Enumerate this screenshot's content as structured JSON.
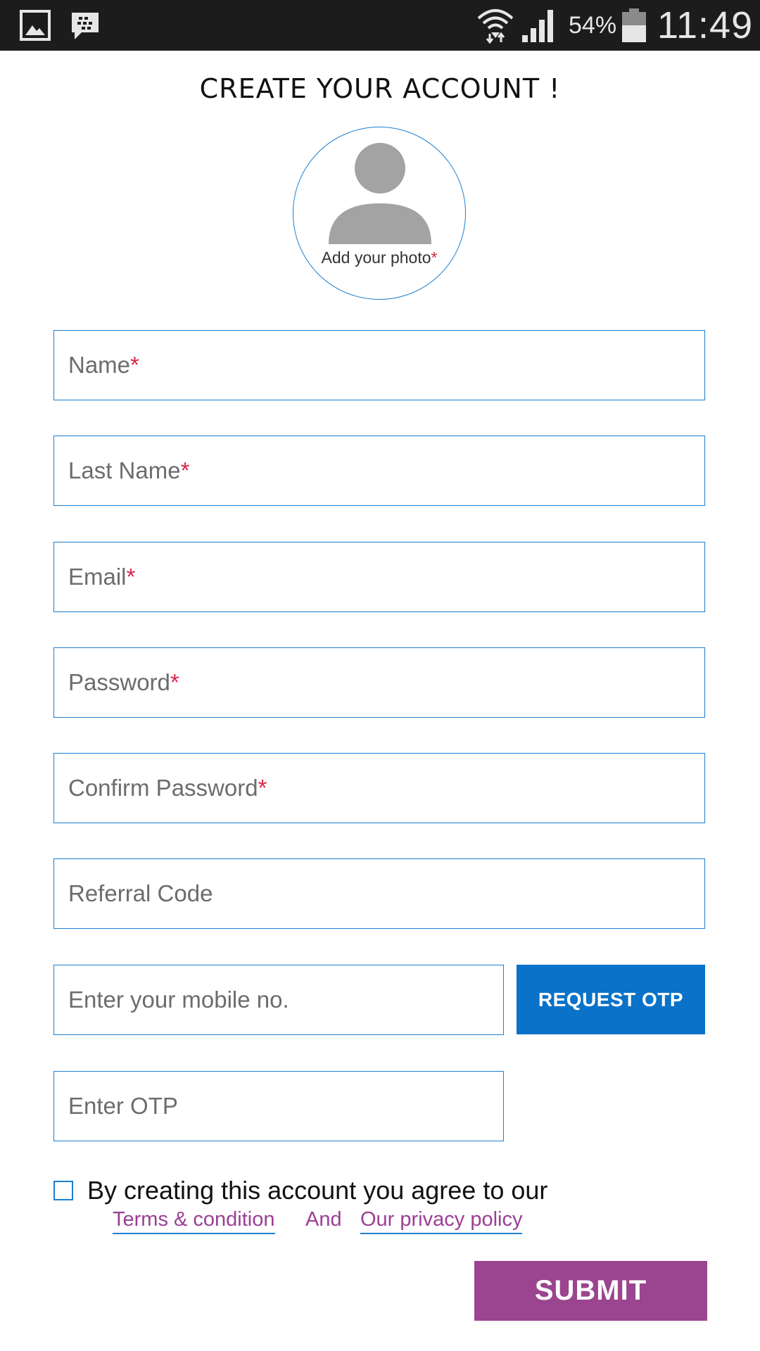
{
  "status_bar": {
    "battery_percent": "54%",
    "time": "11:49",
    "icons": [
      "gallery-icon",
      "bbm-icon",
      "wifi-icon",
      "signal-icon",
      "battery-icon"
    ]
  },
  "header": {
    "title": "CREATE YOUR ACCOUNT !"
  },
  "photo": {
    "label": "Add your photo",
    "required_mark": "*",
    "icon": "avatar-icon"
  },
  "form": {
    "name": {
      "label": "Name",
      "required_mark": "*"
    },
    "last_name": {
      "label": "Last Name",
      "required_mark": "*"
    },
    "email": {
      "label": "Email",
      "required_mark": "*"
    },
    "password": {
      "label": "Password",
      "required_mark": "*"
    },
    "confirm_password": {
      "label": "Confirm Password",
      "required_mark": "*"
    },
    "referral_code": {
      "label": "Referral Code"
    },
    "mobile": {
      "label": "Enter your mobile no."
    },
    "request_otp_label": "REQUEST OTP",
    "otp": {
      "label": "Enter OTP"
    }
  },
  "terms": {
    "text": "By creating this account you agree to our",
    "terms_link": "Terms & condition",
    "and": "And",
    "privacy_link": "Our privacy policy"
  },
  "submit_label": "SUBMIT",
  "colors": {
    "accent_blue": "#1d7fd1",
    "otp_button": "#0a72c8",
    "submit_purple": "#9b448f",
    "link_purple": "#9a3f94",
    "required_red": "#d8274a",
    "status_bar_bg": "#1c1c1c"
  }
}
